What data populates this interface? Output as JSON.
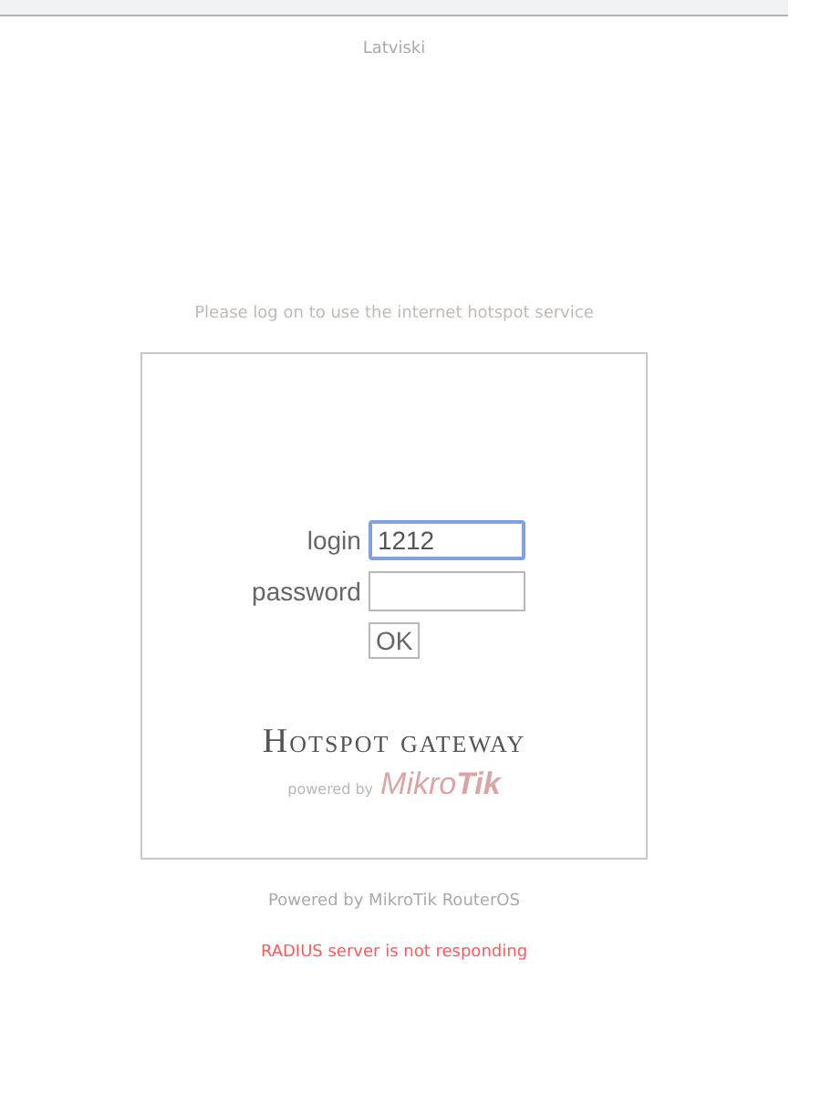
{
  "language_link": "Latviski",
  "notice": "Please log on to use the internet hotspot service",
  "form": {
    "fields": [
      {
        "label": "login",
        "value": "1212",
        "focused": true
      },
      {
        "label": "password",
        "focused": false
      }
    ],
    "submit": "OK"
  },
  "brand": {
    "title": "Hotspot gateway",
    "powered_by": "powered by",
    "logo_left": "Mikro",
    "logo_right": "Tik"
  },
  "footer": "Powered by MikroTik RouterOS",
  "error": "RADIUS server is not responding"
}
